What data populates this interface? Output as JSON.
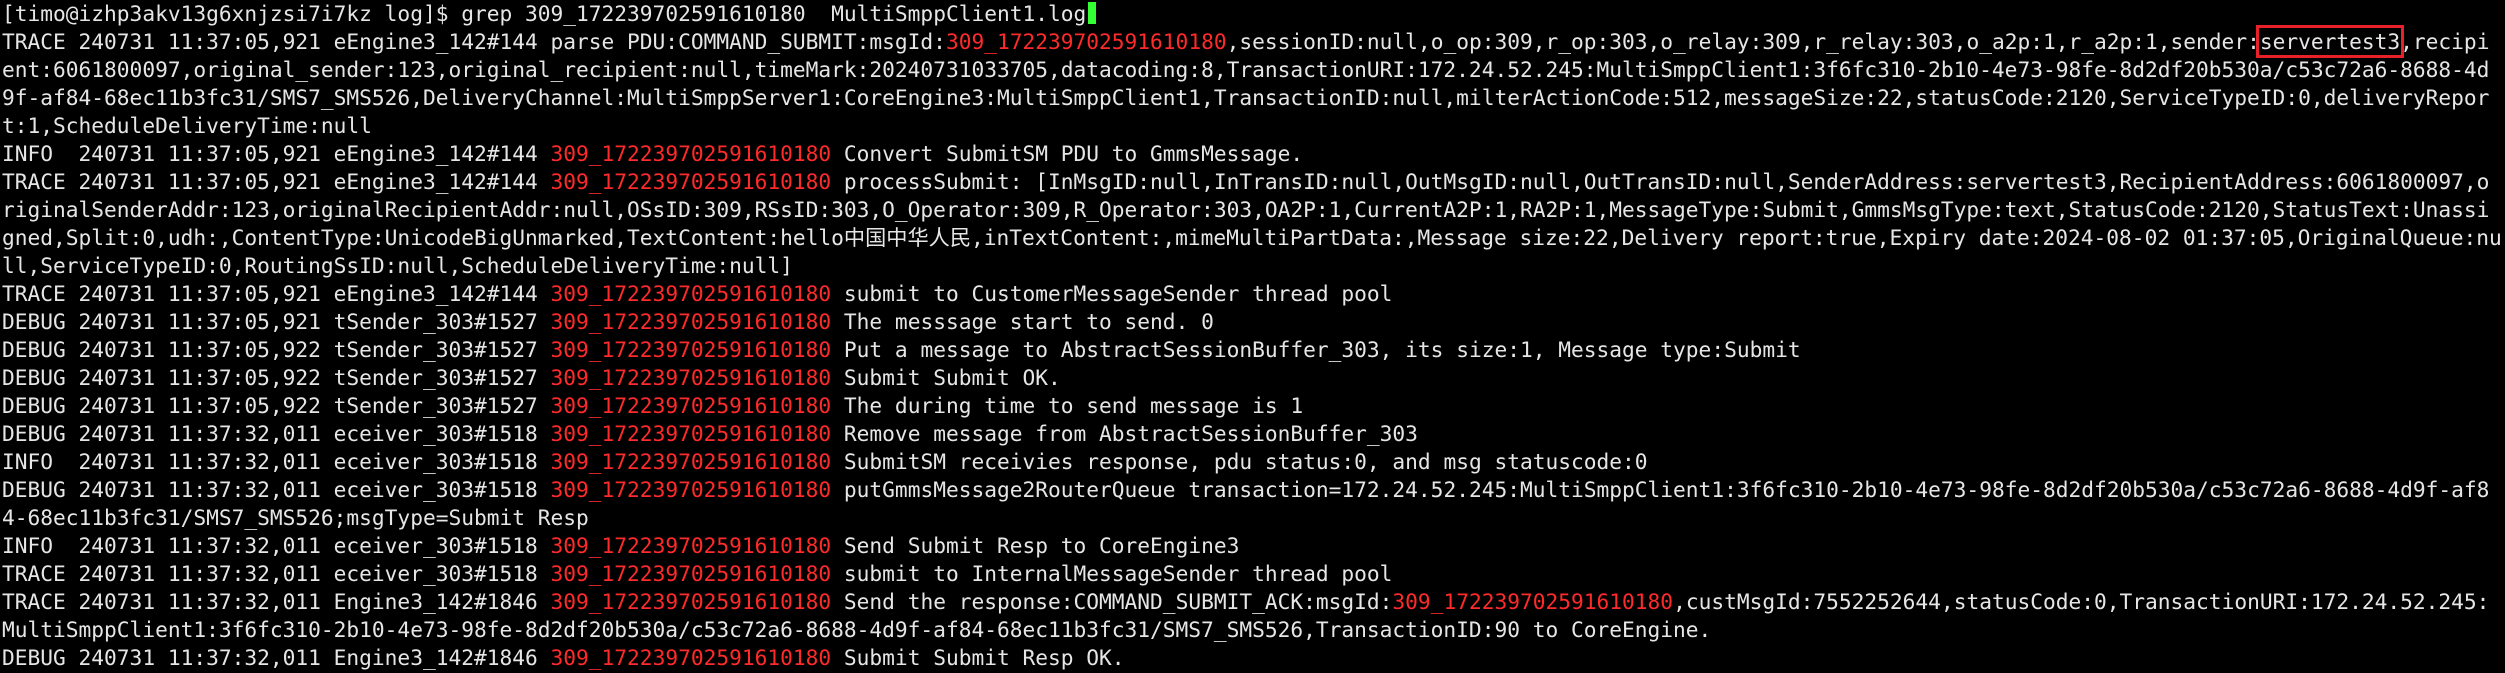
{
  "colors": {
    "background": "#000000",
    "text": "#e6e6e6",
    "msgid_highlight": "#ff2a2a",
    "box": "#e8202a"
  },
  "prompt": {
    "text": "[timo@izhp3akv13g6xnjzsi7i7kz log]$ ",
    "command": "grep 309_172239702591610180  MultiSmppClient1.log"
  },
  "lines": [
    [
      {
        "t": "TRACE 240731 11:37:05,921 eEngine3_142#144 parse PDU:COMMAND_SUBMIT:msgId:"
      },
      {
        "t": "309_172239702591610180",
        "c": "red"
      },
      {
        "t": ",sessionID:null,o_op:309,r_op:303,o_relay:309,r_relay:303,o_a2p:1,r_a2p:1,sender:"
      },
      {
        "t": "servertest3",
        "c": "hl"
      },
      {
        "t": ",recipient:6061800097,original_sender:123,original_recipient:null,timeMark:20240731033705,datacoding:8,TransactionURI:172.24.52.245:MultiSmppClient1:3f6fc310-2b10-4e73-98fe-8d2df20b530a/c53c72a6-8688-4d9f-af84-68ec11b3fc31/SMS7_SMS526,DeliveryChannel:MultiSmppServer1:CoreEngine3:MultiSmppClient1,TransactionID:null,milterActionCode:512,messageSize:22,statusCode:2120,ServiceTypeID:0,deliveryReport:1,ScheduleDeliveryTime:null"
      }
    ],
    [
      {
        "t": "INFO  240731 11:37:05,921 eEngine3_142#144 "
      },
      {
        "t": "309_172239702591610180",
        "c": "red"
      },
      {
        "t": " Convert SubmitSM PDU to GmmsMessage."
      }
    ],
    [
      {
        "t": "TRACE 240731 11:37:05,921 eEngine3_142#144 "
      },
      {
        "t": "309_172239702591610180",
        "c": "red"
      },
      {
        "t": " processSubmit: [InMsgID:null,InTransID:null,OutMsgID:null,OutTransID:null,SenderAddress:servertest3,RecipientAddress:6061800097,originalSenderAddr:123,originalRecipientAddr:null,OSsID:309,RSsID:303,O_Operator:309,R_Operator:303,OA2P:1,CurrentA2P:1,RA2P:1,MessageType:Submit,GmmsMsgType:text,StatusCode:2120,StatusText:Unassigned,Split:0,udh:,ContentType:UnicodeBigUnmarked,TextContent:hello中国中华人民,inTextContent:,mimeMultiPartData:,Message size:22,Delivery report:true,Expiry date:2024-08-02 01:37:05,OriginalQueue:null,ServiceTypeID:0,RoutingSsID:null,ScheduleDeliveryTime:null]"
      }
    ],
    [
      {
        "t": "TRACE 240731 11:37:05,921 eEngine3_142#144 "
      },
      {
        "t": "309_172239702591610180",
        "c": "red"
      },
      {
        "t": " submit to CustomerMessageSender thread pool"
      }
    ],
    [
      {
        "t": "DEBUG 240731 11:37:05,921 tSender_303#1527 "
      },
      {
        "t": "309_172239702591610180",
        "c": "red"
      },
      {
        "t": " The messsage start to send. 0"
      }
    ],
    [
      {
        "t": "DEBUG 240731 11:37:05,922 tSender_303#1527 "
      },
      {
        "t": "309_172239702591610180",
        "c": "red"
      },
      {
        "t": " Put a message to AbstractSessionBuffer_303, its size:1, Message type:Submit"
      }
    ],
    [
      {
        "t": "DEBUG 240731 11:37:05,922 tSender_303#1527 "
      },
      {
        "t": "309_172239702591610180",
        "c": "red"
      },
      {
        "t": " Submit Submit OK."
      }
    ],
    [
      {
        "t": "DEBUG 240731 11:37:05,922 tSender_303#1527 "
      },
      {
        "t": "309_172239702591610180",
        "c": "red"
      },
      {
        "t": " The during time to send message is 1"
      }
    ],
    [
      {
        "t": "DEBUG 240731 11:37:32,011 eceiver_303#1518 "
      },
      {
        "t": "309_172239702591610180",
        "c": "red"
      },
      {
        "t": " Remove message from AbstractSessionBuffer_303"
      }
    ],
    [
      {
        "t": "INFO  240731 11:37:32,011 eceiver_303#1518 "
      },
      {
        "t": "309_172239702591610180",
        "c": "red"
      },
      {
        "t": " SubmitSM receivies response, pdu status:0, and msg statuscode:0"
      }
    ],
    [
      {
        "t": "DEBUG 240731 11:37:32,011 eceiver_303#1518 "
      },
      {
        "t": "309_172239702591610180",
        "c": "red"
      },
      {
        "t": " putGmmsMessage2RouterQueue transaction=172.24.52.245:MultiSmppClient1:3f6fc310-2b10-4e73-98fe-8d2df20b530a/c53c72a6-8688-4d9f-af84-68ec11b3fc31/SMS7_SMS526;msgType=Submit Resp"
      }
    ],
    [
      {
        "t": "INFO  240731 11:37:32,011 eceiver_303#1518 "
      },
      {
        "t": "309_172239702591610180",
        "c": "red"
      },
      {
        "t": " Send Submit Resp to CoreEngine3"
      }
    ],
    [
      {
        "t": "TRACE 240731 11:37:32,011 eceiver_303#1518 "
      },
      {
        "t": "309_172239702591610180",
        "c": "red"
      },
      {
        "t": " submit to InternalMessageSender thread pool"
      }
    ],
    [
      {
        "t": "TRACE 240731 11:37:32,011 Engine3_142#1846 "
      },
      {
        "t": "309_172239702591610180",
        "c": "red"
      },
      {
        "t": " Send the response:COMMAND_SUBMIT_ACK:msgId:"
      },
      {
        "t": "309_172239702591610180",
        "c": "red"
      },
      {
        "t": ",custMsgId:7552252644,statusCode:0,TransactionURI:172.24.52.245:MultiSmppClient1:3f6fc310-2b10-4e73-98fe-8d2df20b530a/c53c72a6-8688-4d9f-af84-68ec11b3fc31/SMS7_SMS526,TransactionID:90 to CoreEngine."
      }
    ],
    [
      {
        "t": "DEBUG 240731 11:37:32,011 Engine3_142#1846 "
      },
      {
        "t": "309_172239702591610180",
        "c": "red"
      },
      {
        "t": " Submit Submit Resp OK."
      }
    ]
  ]
}
